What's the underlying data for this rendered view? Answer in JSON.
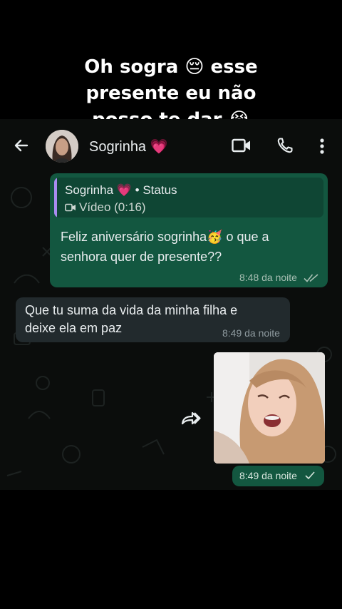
{
  "caption": {
    "line1": "Oh sogra 😔 esse",
    "line2": "presente eu não",
    "line3": "posso te dar 😭"
  },
  "header": {
    "contact_name": "Sogrinha 💗"
  },
  "messages": [
    {
      "direction": "outgoing",
      "quote_author": "Sogrinha 💗 • Status",
      "quote_media": "Vídeo (0:16)",
      "line1": "Feliz aniversário sogrinha🥳 o que a",
      "line2": "senhora quer de presente??",
      "time": "8:48 da noite",
      "status": "read"
    },
    {
      "direction": "incoming",
      "line1": "Que tu suma da vida da minha filha e",
      "line2": "deixe ela em paz",
      "time": "8:49 da noite"
    },
    {
      "direction": "outgoing",
      "type": "image",
      "time": "8:49 da noite",
      "status": "sent"
    }
  ],
  "colors": {
    "outgoing_bubble": "#135740",
    "incoming_bubble": "#222a2d",
    "quote_bar": "#a98bf0"
  }
}
